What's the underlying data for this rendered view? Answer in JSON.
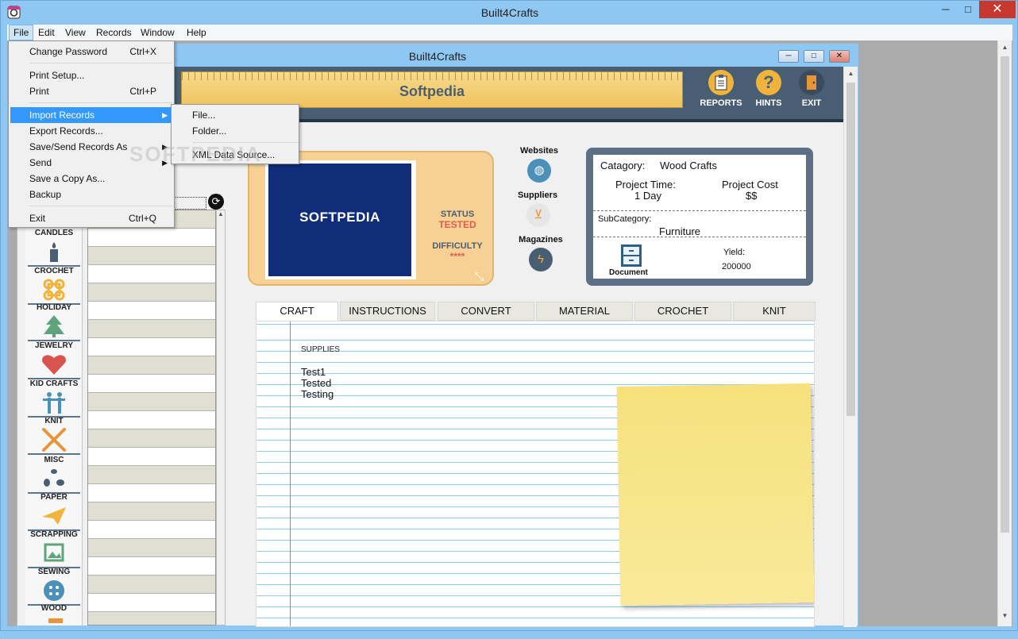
{
  "window": {
    "title": "Built4Crafts",
    "child_title": "Built4Crafts",
    "minimize": "─",
    "maximize": "□",
    "close": "✕"
  },
  "menubar": [
    "File",
    "Edit",
    "View",
    "Records",
    "Window",
    "Help"
  ],
  "file_menu": [
    {
      "label": "Change Password",
      "shortcut": "Ctrl+X"
    },
    {
      "label": "Print Setup...",
      "shortcut": ""
    },
    {
      "label": "Print",
      "shortcut": "Ctrl+P"
    },
    {
      "label": "Import Records",
      "shortcut": "",
      "submenu": true
    },
    {
      "label": "Export Records...",
      "shortcut": ""
    },
    {
      "label": "Save/Send Records As",
      "shortcut": "",
      "submenu": true
    },
    {
      "label": "Send",
      "shortcut": "",
      "submenu": true
    },
    {
      "label": "Save a Copy As...",
      "shortcut": ""
    },
    {
      "label": "Backup",
      "shortcut": ""
    },
    {
      "label": "Exit",
      "shortcut": "Ctrl+Q"
    }
  ],
  "import_submenu": [
    "File...",
    "Folder...",
    "XML Data Source..."
  ],
  "watermark": "SOFTPEDIA",
  "header": {
    "ruler_text": "Softpedia",
    "buttons": [
      {
        "label": "REPORTS",
        "icon": "clipboard-icon"
      },
      {
        "label": "HINTS",
        "icon": "question-icon"
      },
      {
        "label": "EXIT",
        "icon": "door-icon"
      }
    ]
  },
  "categories": [
    "CANDLES",
    "CROCHET",
    "HOLIDAY",
    "JEWELRY",
    "KID CRAFTS",
    "KNIT",
    "MISC",
    "PAPER",
    "SCRAPPING",
    "SEWING",
    "WOOD"
  ],
  "card": {
    "image_text": "SOFTPEDIA",
    "status_label": "STATUS",
    "status_value": "TESTED",
    "difficulty_label": "DIFFICULTY",
    "difficulty_value": "****"
  },
  "links": [
    {
      "label": "Websites",
      "icon": "globe-icon"
    },
    {
      "label": "Suppliers",
      "icon": "basket-icon"
    },
    {
      "label": "Magazines",
      "icon": "lightning-icon"
    }
  ],
  "info": {
    "category_label": "Catagory:",
    "category_value": "Wood Crafts",
    "time_label": "Project Time:",
    "time_value": "1 Day",
    "cost_label": "Project Cost",
    "cost_value": "$$",
    "subcategory_label": "SubCategory:",
    "subcategory_value": "Furniture",
    "document_label": "Document",
    "yield_label": "Yield:",
    "yield_value": "200000"
  },
  "tabs": [
    "CRAFT",
    "INSTRUCTIONS",
    "CONVERT",
    "MATERIAL",
    "CROCHET",
    "KNIT"
  ],
  "page": {
    "supplies_header": "SUPPLIES",
    "supplies": [
      "Test1",
      "Tested",
      "Testing"
    ]
  },
  "colors": {
    "title_bg": "#8ec7f1",
    "header_bg": "#4a5e73",
    "card_bg": "#f7d193",
    "status_color": "#e05c4e",
    "highlight": "#3399ff",
    "sticky": "#f6e17d"
  }
}
